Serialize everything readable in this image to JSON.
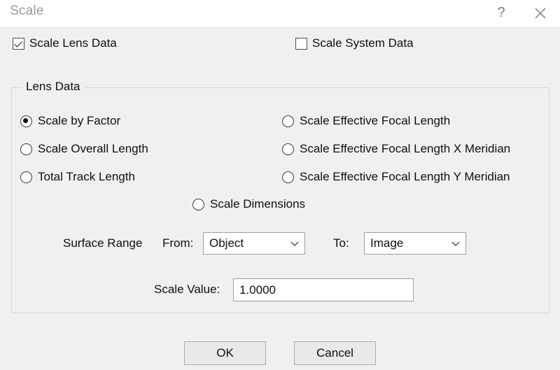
{
  "window": {
    "title": "Scale",
    "help_label": "?",
    "close_label": "✕"
  },
  "top_options": [
    {
      "label": "Scale Lens Data",
      "checked": true
    },
    {
      "label": "Scale System Data",
      "checked": false
    }
  ],
  "lens_data": {
    "legend": "Lens Data",
    "left_column": [
      {
        "label": "Scale by Factor",
        "selected": true
      },
      {
        "label": "Scale Overall Length",
        "selected": false
      },
      {
        "label": "Total Track Length",
        "selected": false
      }
    ],
    "right_column": [
      {
        "label": "Scale Effective Focal Length",
        "selected": false
      },
      {
        "label": "Scale Effective Focal Length X Meridian",
        "selected": false
      },
      {
        "label": "Scale Effective Focal Length Y Meridian",
        "selected": false
      }
    ],
    "center_option": {
      "label": "Scale Dimensions",
      "selected": false
    },
    "surface_range": {
      "label": "Surface Range",
      "from_label": "From:",
      "from_value": "Object",
      "to_label": "To:",
      "to_value": "Image"
    },
    "scale_value": {
      "label": "Scale Value:",
      "value": "1.0000"
    }
  },
  "footer": {
    "ok_label": "OK",
    "cancel_label": "Cancel"
  },
  "colors": {
    "dialog_background": "#f0f0f0",
    "titlebar_background": "#ffffff",
    "title_text": "#9b9b9b",
    "text": "#0f0f0f",
    "field_border": "#a0a0a0",
    "group_border": "#d6d6d6",
    "button_face": "#e9e9e9"
  }
}
